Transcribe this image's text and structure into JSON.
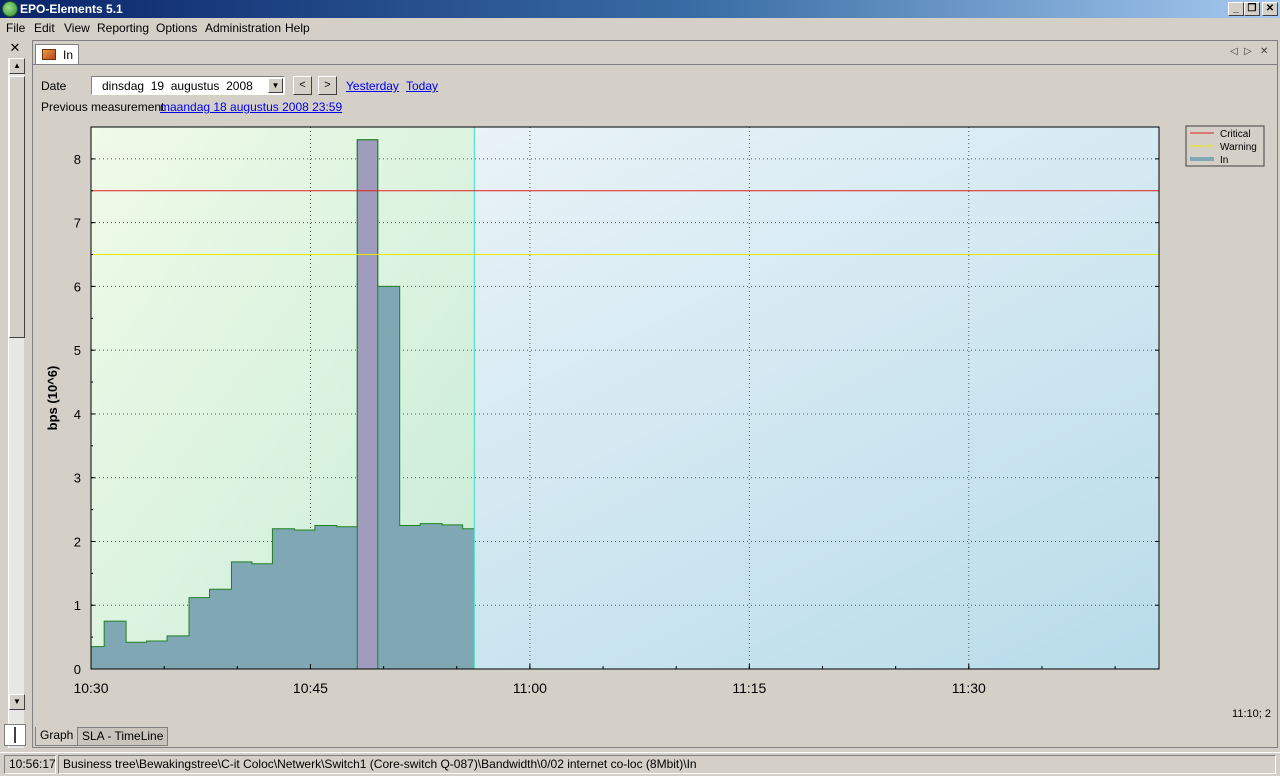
{
  "window": {
    "title": "EPO-Elements 5.1",
    "min": "_",
    "max": "❐",
    "close": "✕"
  },
  "menu": [
    "File",
    "Edit",
    "View",
    "Reporting",
    "Options",
    "Administration",
    "Help"
  ],
  "sidebar": {
    "close": "✕",
    "scroll_up": "▲",
    "scroll_down": "▼"
  },
  "doc_tab": {
    "label": "In",
    "nav_prev": "◁",
    "nav_next": "▷",
    "close": "✕"
  },
  "toolbar": {
    "date_label": "Date",
    "date_value": "dinsdag  19  augustus  2008",
    "dropdown_arrow": "▼",
    "prev_btn": "<",
    "next_btn": ">",
    "yesterday": "Yesterday",
    "today": "Today",
    "previous_label": "Previous measurement",
    "previous_link": "maandag 18 augustus 2008 23:59"
  },
  "colors": {
    "critical": "#e02020",
    "warning": "#e8e800",
    "series_fill": "#7fa8b4",
    "series_line": "#208020",
    "highlight": "#a898c0",
    "past_bg": "#e8f8e0",
    "future_bg": "#cde6f0"
  },
  "chart_data": {
    "type": "area",
    "ylabel": "bps (10^6)",
    "ylim": [
      0,
      8.5
    ],
    "yticks": [
      "0",
      "1",
      "2",
      "3",
      "4",
      "5",
      "6",
      "7",
      "8"
    ],
    "xticks": [
      "10:30",
      "10:45",
      "11:00",
      "11:15",
      "11:30"
    ],
    "xlim_minutes": [
      0,
      73
    ],
    "x_tick_minutes": [
      0,
      15,
      30,
      45,
      60
    ],
    "grid": true,
    "legend_position": "top-right",
    "thresholds": [
      {
        "name": "Critical",
        "value": 7.5
      },
      {
        "name": "Warning",
        "value": 6.5
      }
    ],
    "series": [
      {
        "name": "In",
        "step_start_minutes": [
          0,
          0.9,
          2.4,
          3.8,
          5.2,
          6.7,
          8.1,
          9.6,
          11.0,
          12.4,
          13.9,
          15.3,
          16.8,
          18.2,
          19.6,
          21.1,
          22.5,
          24.0,
          25.4,
          26.2
        ],
        "values": [
          0.35,
          0.75,
          0.42,
          0.44,
          0.52,
          1.12,
          1.25,
          1.68,
          1.65,
          2.2,
          2.18,
          2.25,
          2.23,
          8.3,
          6.0,
          2.25,
          2.28,
          2.26,
          2.2,
          2.2
        ]
      }
    ],
    "highlight_bar_index": 13,
    "current_time_minutes": 26.2
  },
  "coordinate_readout": "11:10; 2",
  "bottom_tabs": [
    "Graph",
    "SLA - TimeLine"
  ],
  "status": {
    "time": "10:56:17",
    "path": "Business tree\\Bewakingstree\\C-it Coloc\\Netwerk\\Switch1 (Core-switch Q-087)\\Bandwidth\\0/02 internet co-loc (8Mbit)\\In"
  }
}
